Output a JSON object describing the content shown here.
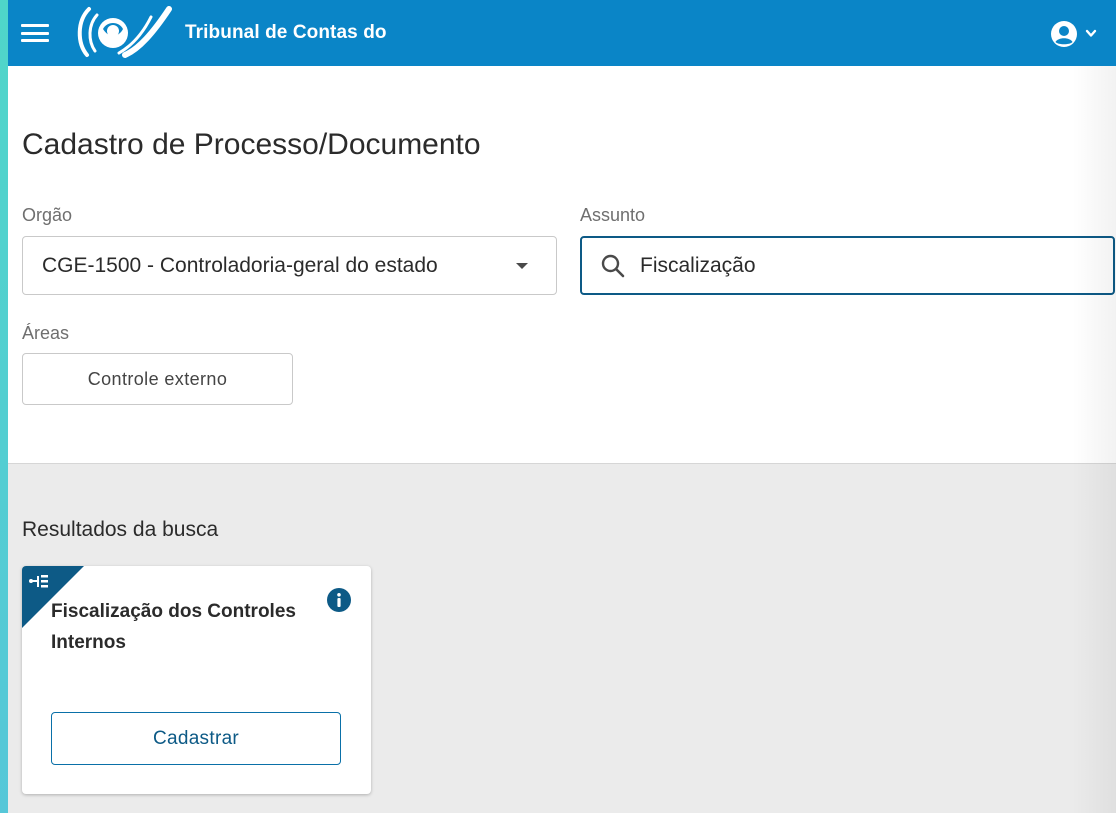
{
  "header": {
    "app_title": "Tribunal de Contas do",
    "menu_icon": "hamburger-menu-icon",
    "logo_icon": "tribunal-logo-icon",
    "user_icon": "account-circle-icon",
    "user_caret_icon": "chevron-down-icon",
    "color": "#0a85c7"
  },
  "page": {
    "title": "Cadastro de Processo/Documento"
  },
  "form": {
    "orgao": {
      "label": "Orgão",
      "value": "CGE-1500 - Controladoria-geral do estado"
    },
    "assunto": {
      "label": "Assunto",
      "value": "Fiscalização",
      "icon": "search-icon"
    },
    "areas": {
      "label": "Áreas",
      "chip": "Controle externo"
    }
  },
  "results": {
    "heading": "Resultados da busca",
    "cards": [
      {
        "title": "Fiscalização dos Controles Internos",
        "corner_icon": "process-tree-icon",
        "info_icon": "info-icon",
        "button": "Cadastrar"
      }
    ]
  },
  "colors": {
    "primary": "#0a85c7",
    "accent_dark": "#0d5a86",
    "background": "#ebebeb"
  }
}
